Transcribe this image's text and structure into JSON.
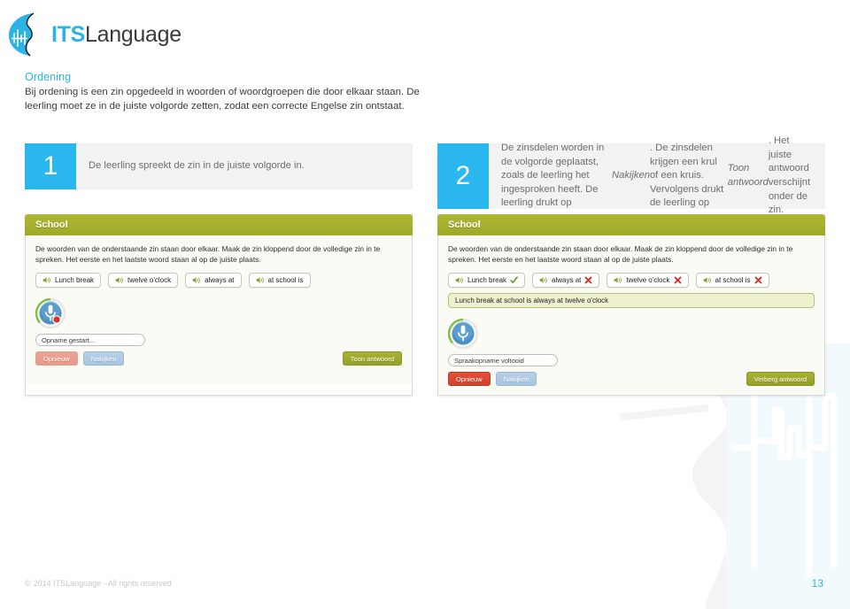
{
  "brand": {
    "logo_icon": "its-face-waveform-logo",
    "name_bold": "ITS",
    "name_rest": "Language"
  },
  "intro": {
    "title": "Ordening",
    "body": "Bij ordening is een zin opgedeeld in woorden of woordgroepen die door elkaar staan. De leerling moet ze in de juiste volgorde zetten, zodat een correcte Engelse zin ontstaat."
  },
  "steps": [
    {
      "number": "1",
      "text": "De leerling spreekt de zin in de juiste volgorde in."
    },
    {
      "number": "2",
      "text_part1": "De zinsdelen worden in de volgorde geplaatst, zoals de leerling het ingesproken heeft. De leerling drukt op ",
      "em1": "Nakijken",
      "text_part2": ". De zinsdelen krijgen een krul of een kruis. Vervolgens drukt de leerling op ",
      "em2": "Toon antwoord",
      "text_part3": ". Het juiste antwoord verschijnt onder de zin."
    }
  ],
  "screenshots": [
    {
      "title": "School",
      "instruction": "De woorden van de onderstaande zin staan door elkaar. Maak de zin kloppend door de volledige zin in te spreken. Het eerste en het laatste woord staan al op de juiste plaats.",
      "chips": [
        {
          "label": "Lunch break",
          "icon": "speaker-icon",
          "mark": "none"
        },
        {
          "label": "twelve o'clock",
          "icon": "speaker-icon",
          "mark": "none"
        },
        {
          "label": "always at",
          "icon": "speaker-icon",
          "mark": "none"
        },
        {
          "label": "at school is",
          "icon": "speaker-icon",
          "mark": "none"
        }
      ],
      "answer_visible": false,
      "answer_sentence": "",
      "mic_icon": "microphone-recording-icon",
      "mic_recording": true,
      "status_text": "Opname gestart...",
      "buttons": {
        "retry": "Opnieuw",
        "check": "Nakijken",
        "answer": "Toon antwoord"
      },
      "retry_enabled": false,
      "check_enabled": false
    },
    {
      "title": "School",
      "instruction": "De woorden van de onderstaande zin staan door elkaar. Maak de zin kloppend door de volledige zin in te spreken. Het eerste en het laatste woord staan al op de juiste plaats.",
      "chips": [
        {
          "label": "Lunch break",
          "icon": "speaker-icon",
          "mark": "check"
        },
        {
          "label": "always at",
          "icon": "speaker-icon",
          "mark": "cross"
        },
        {
          "label": "twelve o'clock",
          "icon": "speaker-icon",
          "mark": "cross"
        },
        {
          "label": "at school is",
          "icon": "speaker-icon",
          "mark": "cross"
        }
      ],
      "answer_visible": true,
      "answer_sentence": "Lunch break at school is always at twelve o'clock",
      "mic_icon": "microphone-icon",
      "mic_recording": false,
      "status_text": "Spraakopname voltooid",
      "buttons": {
        "retry": "Opnieuw",
        "check": "Nakijken",
        "answer": "Verberg antwoord"
      },
      "retry_enabled": true,
      "check_enabled": false
    }
  ],
  "footer": {
    "copyright_symbol": "©",
    "copyright": "2014 ITSLanguage - All rights reserved",
    "page_number": "13"
  },
  "colors": {
    "accent_cyan": "#2ab8ef",
    "olive": "#a8b32e",
    "panel_grey": "#f2f2f2",
    "text_grey": "#6d6d6d",
    "cross_red": "#d52b1e",
    "check_green": "#6fa72b"
  }
}
